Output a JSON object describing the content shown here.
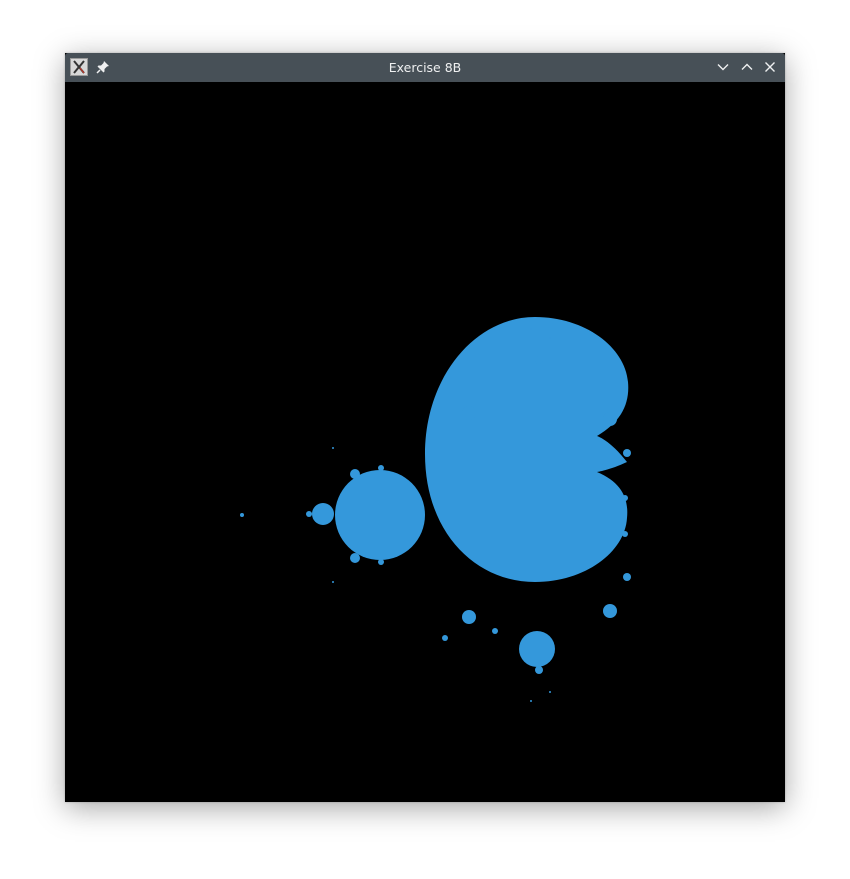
{
  "window": {
    "title": "Exercise 8B",
    "icon": "x11-app-icon",
    "buttons": [
      "pin-icon",
      "minimize-icon",
      "maximize-icon",
      "close-icon"
    ]
  },
  "canvas": {
    "background": "#000000",
    "fractal": "mandelbrot-set",
    "fill_color": "#3498db"
  }
}
